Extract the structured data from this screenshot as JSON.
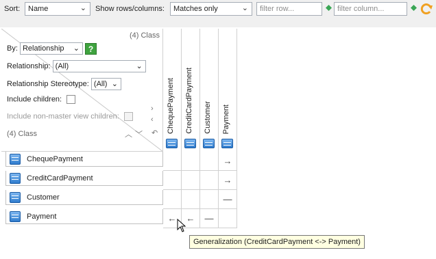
{
  "toolbar": {
    "sort_label": "Sort:",
    "sort_value": "Name",
    "show_label": "Show rows/columns:",
    "show_value": "Matches only",
    "filter_row_placeholder": "filter row...",
    "filter_column_placeholder": "filter column..."
  },
  "config": {
    "class_count_top": "(4) Class",
    "by_label": "By:",
    "by_value": "Relationship",
    "help_label": "?",
    "relationship_label": "Relationship:",
    "relationship_value": "(All)",
    "stereotype_label": "Relationship Stereotype:",
    "stereotype_value": "(All)",
    "include_children_label": "Include children:",
    "include_nonmaster_label": "Include non-master view children:",
    "class_count_bottom": "(4) Class"
  },
  "columns": [
    {
      "name": "ChequePayment"
    },
    {
      "name": "CreditCardPayment"
    },
    {
      "name": "Customer"
    },
    {
      "name": "Payment"
    }
  ],
  "rows": [
    {
      "name": "ChequePayment",
      "cells": [
        "",
        "",
        "",
        "→"
      ]
    },
    {
      "name": "CreditCardPayment",
      "cells": [
        "",
        "",
        "",
        "→"
      ]
    },
    {
      "name": "Customer",
      "cells": [
        "",
        "",
        "",
        "—"
      ]
    },
    {
      "name": "Payment",
      "cells": [
        "←",
        "←",
        "—",
        ""
      ]
    }
  ],
  "tooltip": "Generalization (CreditCardPayment <-> Payment)",
  "colors": {
    "accent": "#2f7ccd",
    "help": "#3fa33f",
    "tooltip_bg": "#ffffe1"
  }
}
